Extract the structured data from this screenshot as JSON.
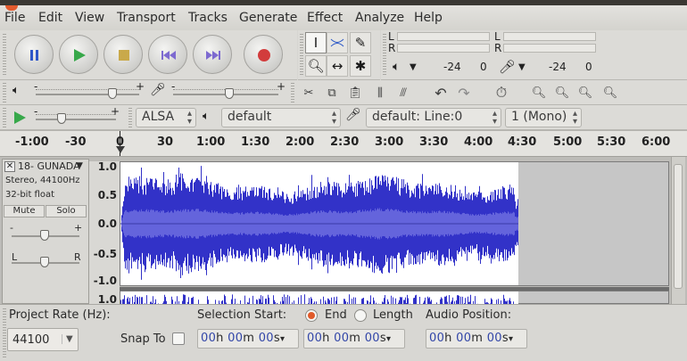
{
  "menu": [
    "File",
    "Edit",
    "View",
    "Transport",
    "Tracks",
    "Generate",
    "Effect",
    "Analyze",
    "Help"
  ],
  "transport": {
    "pause": "pause-icon",
    "play": "play-icon",
    "stop": "stop-icon",
    "skip_start": "skip-to-start-icon",
    "skip_end": "skip-to-end-icon",
    "record": "record-icon"
  },
  "meters": {
    "rec_L": "L",
    "rec_R": "R",
    "play_L": "L",
    "play_R": "R",
    "rec_db_a": "-24",
    "rec_db_b": "0",
    "play_db_a": "-24",
    "play_db_b": "0"
  },
  "mixer": {
    "out_minus": "-",
    "out_plus": "+",
    "in_minus": "-",
    "in_plus": "+"
  },
  "device": {
    "host": "ALSA",
    "output": "default",
    "input": "default: Line:0",
    "channels": "1 (Mono)"
  },
  "ruler": {
    "ticks": [
      "-1:00",
      "-30",
      "0",
      "30",
      "1:00",
      "1:30",
      "2:00",
      "2:30",
      "3:00",
      "3:30",
      "4:00",
      "4:30",
      "5:00",
      "5:30",
      "6:00"
    ]
  },
  "track": {
    "name": "18- GUNADA",
    "info1": "Stereo, 44100Hz",
    "info2": "32-bit float",
    "mute": "Mute",
    "solo": "Solo",
    "pan_L": "L",
    "pan_R": "R",
    "gain_minus": "-",
    "gain_plus": "+",
    "scale": [
      "1.0",
      "0.5",
      "0.0",
      "-0.5",
      "-1.0"
    ],
    "scale2_top": "1.0"
  },
  "selection_bar": {
    "project_rate_label": "Project Rate (Hz):",
    "project_rate": "44100",
    "snap_to": "Snap To",
    "selection_start_label": "Selection Start:",
    "end_label": "End",
    "length_label": "Length",
    "audio_position_label": "Audio Position:",
    "time": {
      "h": "00",
      "hu": "h",
      "m": "00",
      "mu": "m",
      "s": "00",
      "su": "s"
    }
  },
  "colors": {
    "waveform": "#3232c8",
    "waveform_rms": "#6464dc",
    "record": "#d23c3c",
    "play": "#37a84a",
    "accent": "#e05a2a"
  }
}
